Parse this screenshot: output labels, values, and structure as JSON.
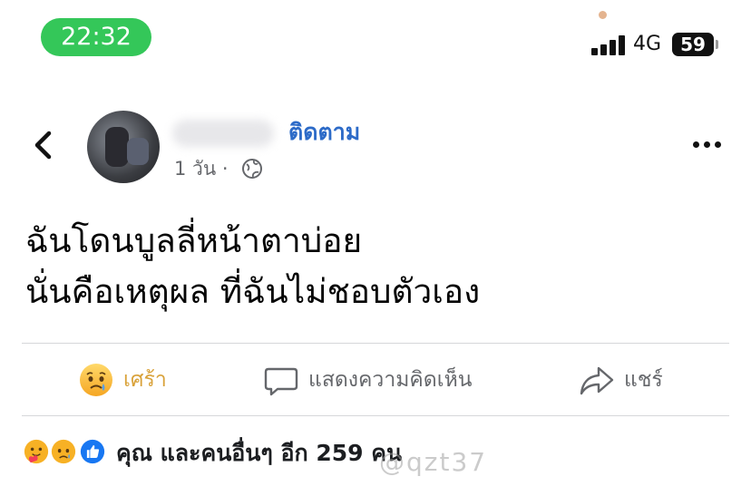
{
  "status_bar": {
    "time": "22:32",
    "network": "4G",
    "battery": "59"
  },
  "post": {
    "author_name": "",
    "follow_label": "ติดตาม",
    "timestamp": "1 วัน",
    "separator": "·",
    "privacy_icon": "globe-icon",
    "text_lines": [
      "ฉันโดนบูลลี่หน้าตาบ่อย",
      "นั่นคือเหตุผล ที่ฉันไม่ชอบตัวเอง"
    ]
  },
  "actions": {
    "reaction_label": "เศร้า",
    "comment_label": "แสดงความคิดเห็น",
    "share_label": "แชร์"
  },
  "reactions_summary": {
    "icons": [
      "care-icon",
      "sad-icon",
      "like-icon"
    ],
    "text": "คุณ และคนอื่นๆ อีก 259 คน"
  },
  "watermark": "@qzt37",
  "colors": {
    "time_pill": "#34c759",
    "follow_blue": "#2d6bc8",
    "sad_reaction": "#d9a23a",
    "like_blue": "#1877f2"
  }
}
